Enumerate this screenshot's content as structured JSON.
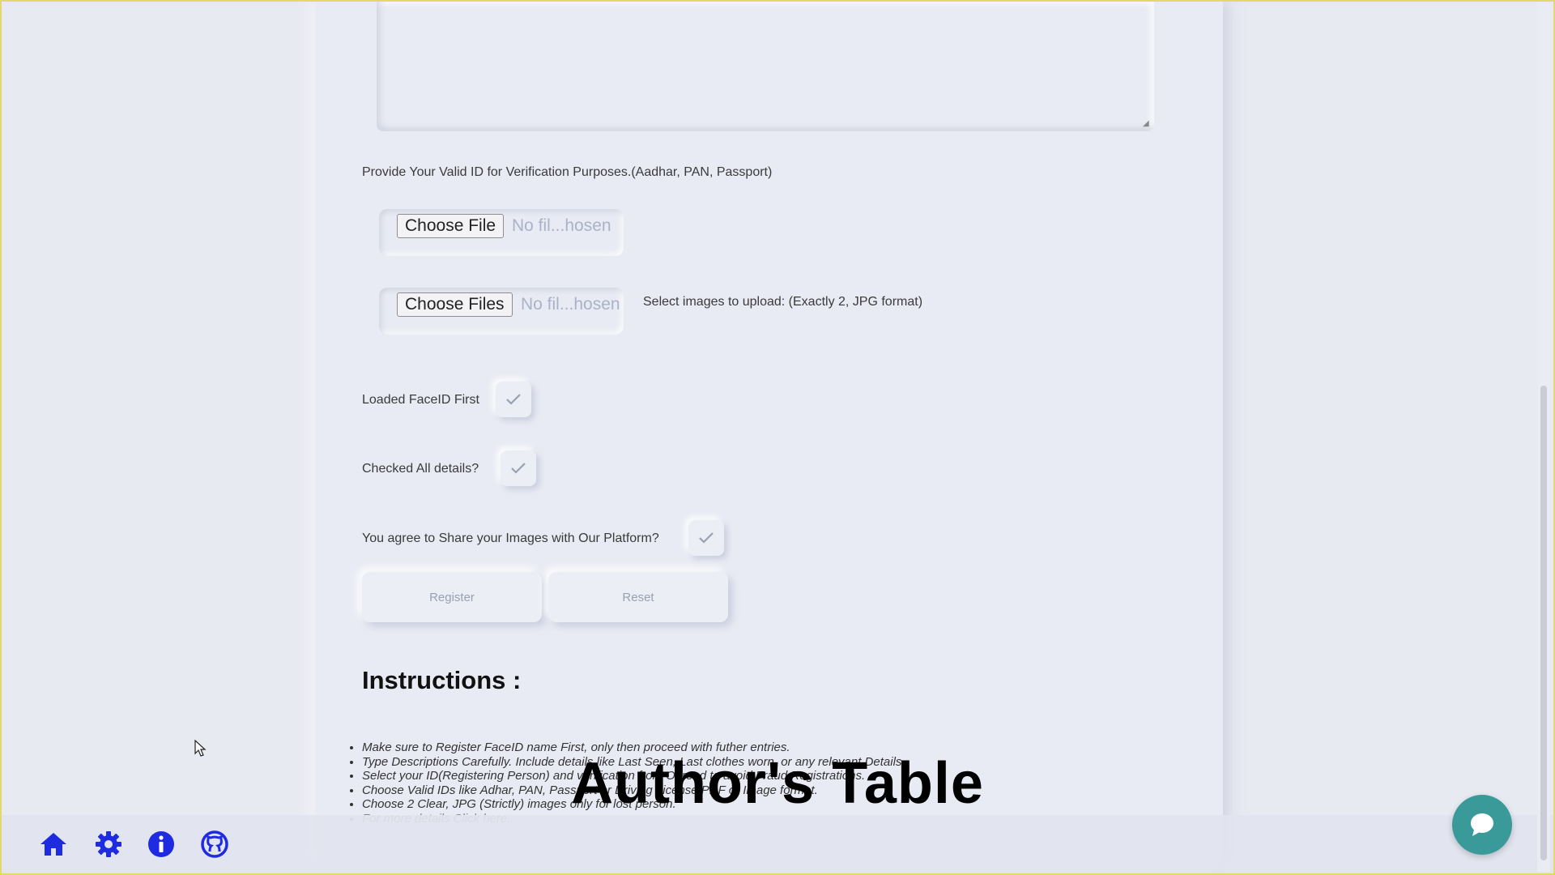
{
  "form": {
    "id_label": "Provide Your Valid ID for Verification Purposes.(Aadhar, PAN, Passport)",
    "id_file": {
      "button": "Choose File",
      "status": "No fil...hosen"
    },
    "images_file": {
      "button": "Choose Files",
      "status": "No fil...hosen",
      "hint": "Select images to upload: (Exactly 2, JPG format)"
    },
    "checks": [
      {
        "label": "Loaded FaceID First"
      },
      {
        "label": "Checked All details?"
      },
      {
        "label": "You agree to Share your Images with Our Platform?"
      }
    ],
    "register_label": "Register",
    "reset_label": "Reset"
  },
  "instructions": {
    "heading": "Instructions :",
    "items": [
      "Make sure to Register FaceID name First, only then proceed with futher entries.",
      "Type Descriptions Carefully. Include details like Last Seen, Last clothes worn, or any relevant Details.",
      "Select your ID(Registering Person) and verification from Ourend to avoid Fraud Registrations.",
      "Choose Valid IDs like Adhar, PAN, Passport or Driving License PDF or Image format.",
      "Choose 2 Clear, JPG (Strictly) images only for lost person."
    ],
    "more": "For more details Click here.."
  },
  "overlay_caption": "Author's Table",
  "bottom_bar": {
    "icons": [
      "home-icon",
      "gear-icon",
      "info-icon",
      "github-icon"
    ],
    "icon_color": "#1f2be0"
  },
  "chat": {
    "icon": "chat-bubble-icon",
    "color": "#3a9a9a"
  }
}
